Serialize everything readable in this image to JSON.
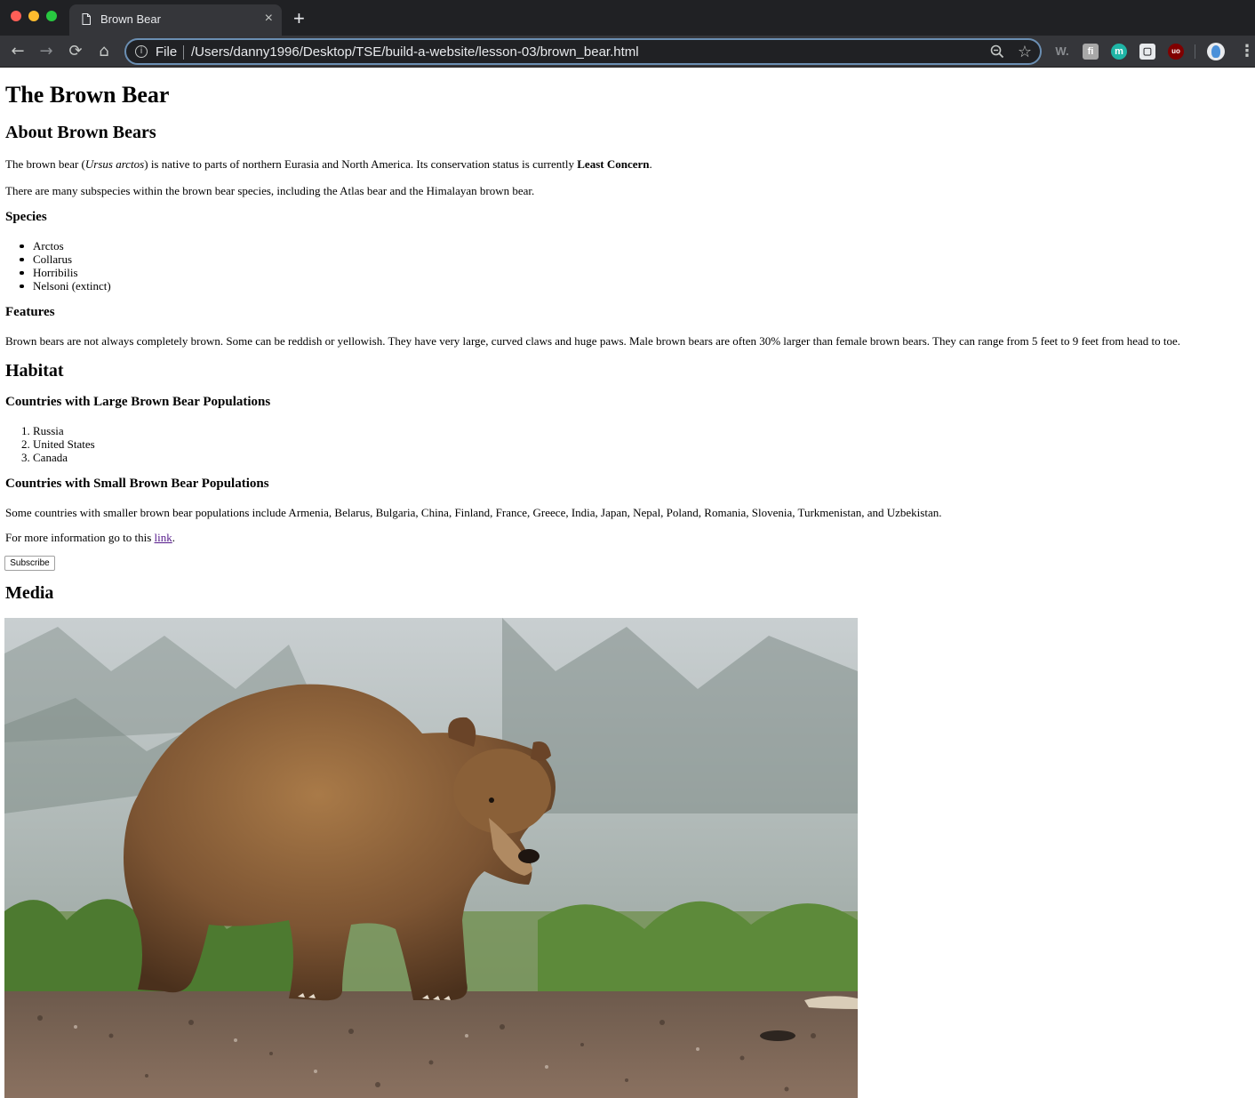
{
  "browser": {
    "tab_title": "Brown Bear",
    "tab_close": "×",
    "new_tab": "+",
    "scheme_label": "File",
    "url": "/Users/danny1996/Desktop/TSE/build-a-website/lesson-03/brown_bear.html",
    "icons": [
      "back-icon",
      "forward-icon",
      "reload-icon",
      "home-icon",
      "info-icon",
      "zoom-icon",
      "star-icon",
      "menu-icon"
    ],
    "extensions": [
      {
        "name": "ext-w",
        "label": "W."
      },
      {
        "name": "ext-f",
        "label": "ﬁ"
      },
      {
        "name": "ext-m",
        "label": "m"
      },
      {
        "name": "ext-doc",
        "label": "▢"
      },
      {
        "name": "ext-ub",
        "label": "uo"
      }
    ]
  },
  "content": {
    "title": "The Brown Bear",
    "about_heading": "About Brown Bears",
    "about_p1": {
      "pre": "The brown bear (",
      "sci": "Ursus arctos",
      "mid": ") is native to parts of northern Eurasia and North America. Its conservation status is currently ",
      "status": "Least Concern",
      "post": "."
    },
    "about_p2": "There are many subspecies within the brown bear species, including the Atlas bear and the Himalayan brown bear.",
    "species_heading": "Species",
    "species": [
      "Arctos",
      "Collarus",
      "Horribilis",
      "Nelsoni (extinct)"
    ],
    "features_heading": "Features",
    "features_text": "Brown bears are not always completely brown. Some can be reddish or yellowish. They have very large, curved claws and huge paws. Male brown bears are often 30% larger than female brown bears. They can range from 5 feet to 9 feet from head to toe.",
    "habitat_heading": "Habitat",
    "large_pop_heading": "Countries with Large Brown Bear Populations",
    "large_pop": [
      "Russia",
      "United States",
      "Canada"
    ],
    "small_pop_heading": "Countries with Small Brown Bear Populations",
    "small_pop_text": "Some countries with smaller brown bear populations include Armenia, Belarus, Bulgaria, China, Finland, France, Greece, India, Japan, Nepal, Poland, Romania, Slovenia, Turkmenistan, and Uzbekistan.",
    "more_info": {
      "pre": "For more information go to this ",
      "link": "link",
      "post": "."
    },
    "subscribe_label": "Subscribe",
    "media_heading": "Media",
    "image": "brown-bear-photo"
  }
}
